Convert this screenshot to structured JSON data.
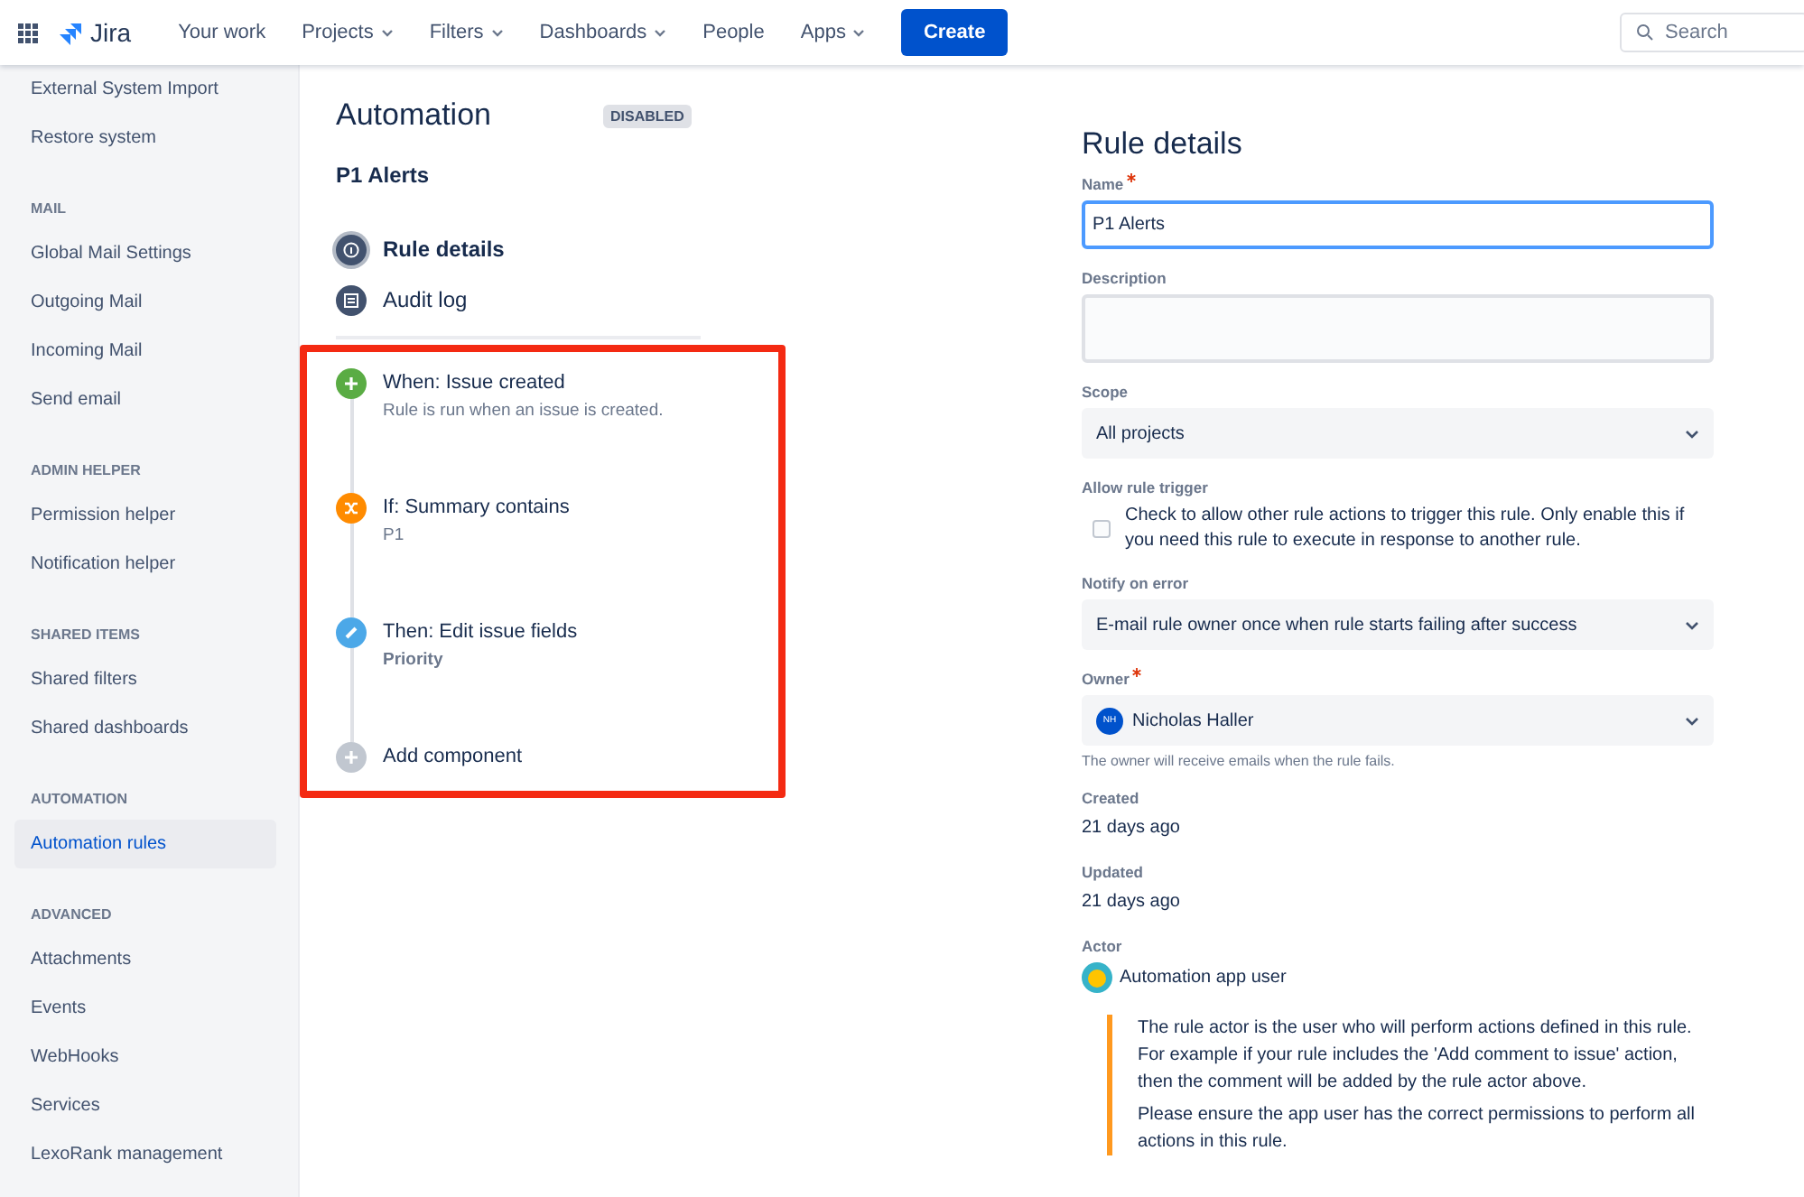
{
  "topbar": {
    "product": "Jira",
    "nav": [
      {
        "label": "Your work",
        "dropdown": false
      },
      {
        "label": "Projects",
        "dropdown": true
      },
      {
        "label": "Filters",
        "dropdown": true
      },
      {
        "label": "Dashboards",
        "dropdown": true
      },
      {
        "label": "People",
        "dropdown": false
      },
      {
        "label": "Apps",
        "dropdown": true
      }
    ],
    "create": "Create",
    "search": {
      "placeholder": "Search"
    }
  },
  "sidebar": {
    "sections": [
      {
        "items": [
          {
            "label": "External System Import",
            "selected": false
          },
          {
            "label": "Restore system",
            "selected": false
          }
        ]
      },
      {
        "heading": "MAIL",
        "items": [
          {
            "label": "Global Mail Settings",
            "selected": false
          },
          {
            "label": "Outgoing Mail",
            "selected": false
          },
          {
            "label": "Incoming Mail",
            "selected": false
          },
          {
            "label": "Send email",
            "selected": false
          }
        ]
      },
      {
        "heading": "ADMIN HELPER",
        "items": [
          {
            "label": "Permission helper",
            "selected": false
          },
          {
            "label": "Notification helper",
            "selected": false
          }
        ]
      },
      {
        "heading": "SHARED ITEMS",
        "items": [
          {
            "label": "Shared filters",
            "selected": false
          },
          {
            "label": "Shared dashboards",
            "selected": false
          }
        ]
      },
      {
        "heading": "AUTOMATION",
        "items": [
          {
            "label": "Automation rules",
            "selected": true
          }
        ]
      },
      {
        "heading": "ADVANCED",
        "items": [
          {
            "label": "Attachments",
            "selected": false
          },
          {
            "label": "Events",
            "selected": false
          },
          {
            "label": "WebHooks",
            "selected": false
          },
          {
            "label": "Services",
            "selected": false
          },
          {
            "label": "LexoRank management",
            "selected": false
          }
        ]
      }
    ]
  },
  "rule": {
    "title": "Automation",
    "status": "DISABLED",
    "name": "P1 Alerts",
    "menu": [
      {
        "kind": "details",
        "label": "Rule details",
        "selected": true
      },
      {
        "kind": "audit",
        "label": "Audit log",
        "selected": false
      }
    ],
    "steps": [
      {
        "kind": "trigger",
        "title": "When: Issue created",
        "detail": "Rule is run when an issue is created."
      },
      {
        "kind": "condition",
        "title": "If: Summary contains",
        "detail": "P1"
      },
      {
        "kind": "action",
        "title": "Then: Edit issue fields",
        "detail": "Priority"
      },
      {
        "kind": "add",
        "title": "Add component"
      }
    ]
  },
  "details": {
    "title": "Rule details",
    "fields": [
      {
        "kind": "text",
        "label": "Name",
        "required": true,
        "value": "P1 Alerts"
      },
      {
        "kind": "textarea",
        "label": "Description",
        "required": false
      },
      {
        "kind": "select",
        "label": "Scope",
        "required": false,
        "value": "All projects"
      },
      {
        "kind": "checkbox",
        "label": "Allow rule trigger",
        "required": false,
        "checked": false,
        "text": "Check to allow other rule actions to trigger this rule. Only enable this if you need this rule to execute in response to another rule."
      },
      {
        "kind": "select",
        "label": "Notify on error",
        "required": false,
        "value": "E-mail rule owner once when rule starts failing after success"
      },
      {
        "kind": "user",
        "label": "Owner",
        "required": true,
        "value": "Nicholas Haller",
        "initials": "NH",
        "help": "The owner will receive emails when the rule fails."
      },
      {
        "kind": "static",
        "label": "Created",
        "required": false,
        "value": "21 days ago"
      },
      {
        "kind": "static",
        "label": "Updated",
        "required": false,
        "value": "21 days ago"
      },
      {
        "kind": "actor",
        "label": "Actor",
        "required": false,
        "value": "Automation app user",
        "notes": [
          "The rule actor is the user who will perform actions defined in this rule. For example if your rule includes the 'Add comment to issue' action, then the comment will be added by the rule actor above.",
          "Please ensure the app user has the correct permissions to perform all actions in this rule."
        ]
      }
    ]
  }
}
